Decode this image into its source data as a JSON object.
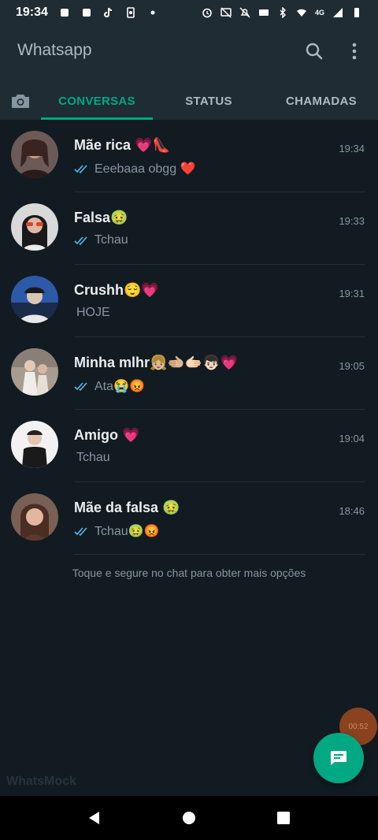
{
  "status_bar": {
    "time": "19:34",
    "network_label": "4G"
  },
  "header": {
    "title": "Whatsapp"
  },
  "tabs": [
    {
      "label": "CONVERSAS",
      "active": true
    },
    {
      "label": "STATUS",
      "active": false
    },
    {
      "label": "CHAMADAS",
      "active": false
    }
  ],
  "chats": [
    {
      "name": "Mãe rica 💗👠",
      "time": "19:34",
      "message": "Eeebaaa obgg ❤️",
      "read": true
    },
    {
      "name": "Falsa🤢",
      "time": "19:33",
      "message": "Tchau",
      "read": true
    },
    {
      "name": "Crushh😌💗",
      "time": "19:31",
      "message": "HOJE",
      "read": false
    },
    {
      "name": "Minha mlhr👧🏼🫲🏼🫱🏻👦🏻💗",
      "time": "19:05",
      "message": "Ata😭😡",
      "read": true
    },
    {
      "name": "Amigo 💗",
      "time": "19:04",
      "message": "Tchau",
      "read": false
    },
    {
      "name": "Mãe da falsa 🤢",
      "time": "18:46",
      "message": "Tchau🤢😡",
      "read": true
    }
  ],
  "hint": "Toque e segure no chat para obter mais opções",
  "timer_badge": "00:52",
  "watermark": "WhatsMock",
  "colors": {
    "accent": "#00a884",
    "background": "#121b22",
    "app_bar": "#1f2c34",
    "read_ticks": "#53bdeb"
  }
}
